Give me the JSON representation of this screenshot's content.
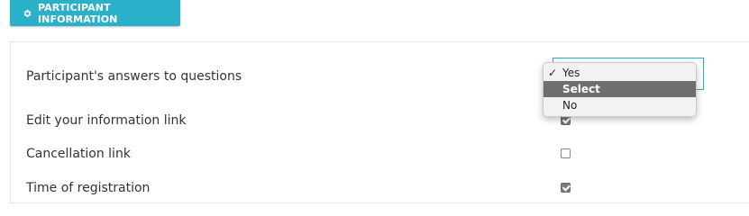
{
  "header": {
    "tab_label": "PARTICIPANT INFORMATION",
    "icon": "gear-icon"
  },
  "rows": [
    {
      "label": "Participant's answers to questions",
      "control": "select",
      "value": "Select"
    },
    {
      "label": "Edit your information link",
      "control": "checkbox",
      "checked": true
    },
    {
      "label": "Cancellation link",
      "control": "checkbox",
      "checked": false
    },
    {
      "label": "Time of registration",
      "control": "checkbox",
      "checked": true
    }
  ],
  "dropdown": {
    "options": [
      "Yes",
      "Select",
      "No"
    ],
    "checked_option": "Yes",
    "highlighted_option": "Select"
  },
  "colors": {
    "accent": "#2bb0c9",
    "highlight": "#6e6e6e"
  }
}
